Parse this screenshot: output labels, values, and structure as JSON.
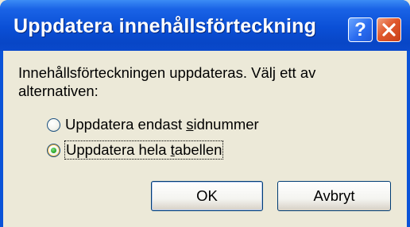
{
  "dialog": {
    "title": "Uppdatera innehållsförteckning",
    "help_label": "?",
    "message": "Innehållsförteckningen uppdateras. Välj ett av alternativen:",
    "options": [
      {
        "label_before": "Uppdatera endast ",
        "accel": "s",
        "label_after": "idnummer",
        "checked": false
      },
      {
        "label_before": "Uppdatera hela ",
        "accel": "t",
        "label_after": "abellen",
        "checked": true
      }
    ],
    "ok_label": "OK",
    "cancel_label": "Avbryt"
  },
  "colors": {
    "titlebar": "#0a4fd6",
    "dialog_bg": "#ece9d8",
    "close_button": "#e0582c",
    "radio_dot": "#21a121"
  },
  "icons": {
    "help": "help-icon",
    "close": "close-icon"
  }
}
